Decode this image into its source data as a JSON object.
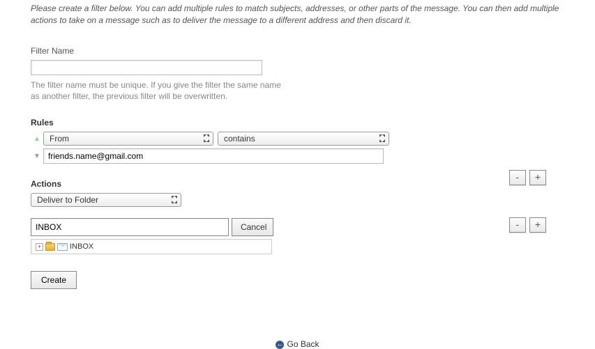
{
  "intro": "Please create a filter below. You can add multiple rules to match subjects, addresses, or other parts of the message. You can then add multiple actions to take on a message such as to deliver the message to a different address and then discard it.",
  "filterName": {
    "label": "Filter Name",
    "value": "",
    "help": "The filter name must be unique. If you give the filter the same name as another filter, the previous filter will be overwritten."
  },
  "rules": {
    "title": "Rules",
    "field": "From",
    "condition": "contains",
    "value": "friends.name@gmail.com"
  },
  "actions": {
    "title": "Actions",
    "action": "Deliver to Folder",
    "folderValue": "INBOX",
    "cancelLabel": "Cancel",
    "treeLabel": "INBOX"
  },
  "buttons": {
    "minus": "-",
    "plus": "+",
    "create": "Create",
    "goback": "Go Back",
    "expand": "+"
  }
}
